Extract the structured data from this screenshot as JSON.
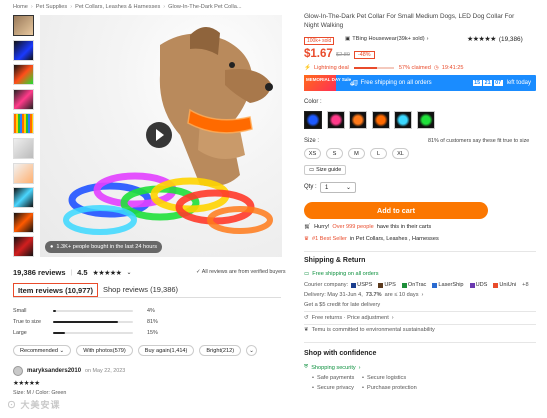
{
  "breadcrumb": [
    "Home",
    "Pet Supplies",
    "Pet Collars, Leashes & Harnesses",
    "Glow-In-The-Dark Pet Colla..."
  ],
  "gallery": {
    "overlay": "1.3K+ people bought in the last 24 hours"
  },
  "reviews": {
    "count_label": "19,386 reviews",
    "rating": "4.5",
    "verified_note": "All reviews are from verified buyers",
    "tab_item": "Item reviews (10,977)",
    "tab_shop": "Shop reviews (19,386)",
    "fit": [
      {
        "label": "Small",
        "value": 4,
        "pct_label": "4%"
      },
      {
        "label": "True to size",
        "value": 81,
        "pct_label": "81%"
      },
      {
        "label": "Large",
        "value": 15,
        "pct_label": "15%"
      }
    ],
    "filters": [
      "Recommended",
      "With photos(579)",
      "Buy again(1,414)",
      "Bright(212)"
    ],
    "first_review": {
      "user": "maryksanders2010",
      "date": "on May 22, 2023",
      "size_color": "Size: M / Color: Green"
    }
  },
  "watermark": "⊙ 大美安课",
  "product": {
    "title": "Glow-In-The-Dark Pet Collar For Small Medium Dogs, LED Dog Collar For Night Walking",
    "sold_tag": "100k+ sold",
    "seller": "TBing Housewear(39k+ sold)",
    "rating_count": "(19,386)",
    "price": "$1.67",
    "old_price": "$2.89",
    "discount": "-48%",
    "lightning_label": "Lightning deal",
    "claimed_label": "57% claimed",
    "claimed_fraction": 0.57,
    "countdown": "19:41:25",
    "banner": {
      "badge": "MEMORIAL DAY Sale",
      "shipping": "Free shipping on all orders",
      "timer": [
        "15",
        "21",
        "07"
      ],
      "left": "left today"
    },
    "color_label": "Color :",
    "colors": [
      "#1d5aff",
      "#ff3a8a",
      "#ff7a1a",
      "#ff6a00",
      "#3bd8ff",
      "#1fe03a"
    ],
    "size_label": "Size :",
    "sizes": [
      "XS",
      "S",
      "M",
      "L",
      "XL"
    ],
    "fit_note": "81% of customers say these fit true to size",
    "size_guide": "Size guide",
    "qty_label": "Qty :",
    "qty_value": "1",
    "add_to_cart": "Add to cart",
    "hurry_prefix": "Hurry!",
    "hurry_count": "Over 999 people",
    "hurry_suffix": "have this in their carts",
    "best_seller": "#1 Best Seller",
    "best_category": "in Pet Collars, Leashes , Harnesses"
  },
  "shipping": {
    "title": "Shipping & Return",
    "free": "Free shipping on all orders",
    "courier_label": "Courier company:",
    "carriers": [
      "USPS",
      "UPS",
      "OnTrac",
      "LaserShip",
      "UDS",
      "UniUni",
      "+8"
    ],
    "delivery_prefix": "Delivery: May 31-Jun 4,",
    "delivery_pct": "73.7%",
    "delivery_suffix": "are ≤ 10 days",
    "credit": "Get a $5 credit for late delivery",
    "returns": "Free returns · Price adjustment",
    "env": "Temu is committed to environmental sustainability"
  },
  "confidence": {
    "title": "Shop with confidence",
    "security": "Shopping security",
    "items": [
      "Safe payments",
      "Secure logistics",
      "Secure privacy",
      "Purchase protection"
    ]
  }
}
